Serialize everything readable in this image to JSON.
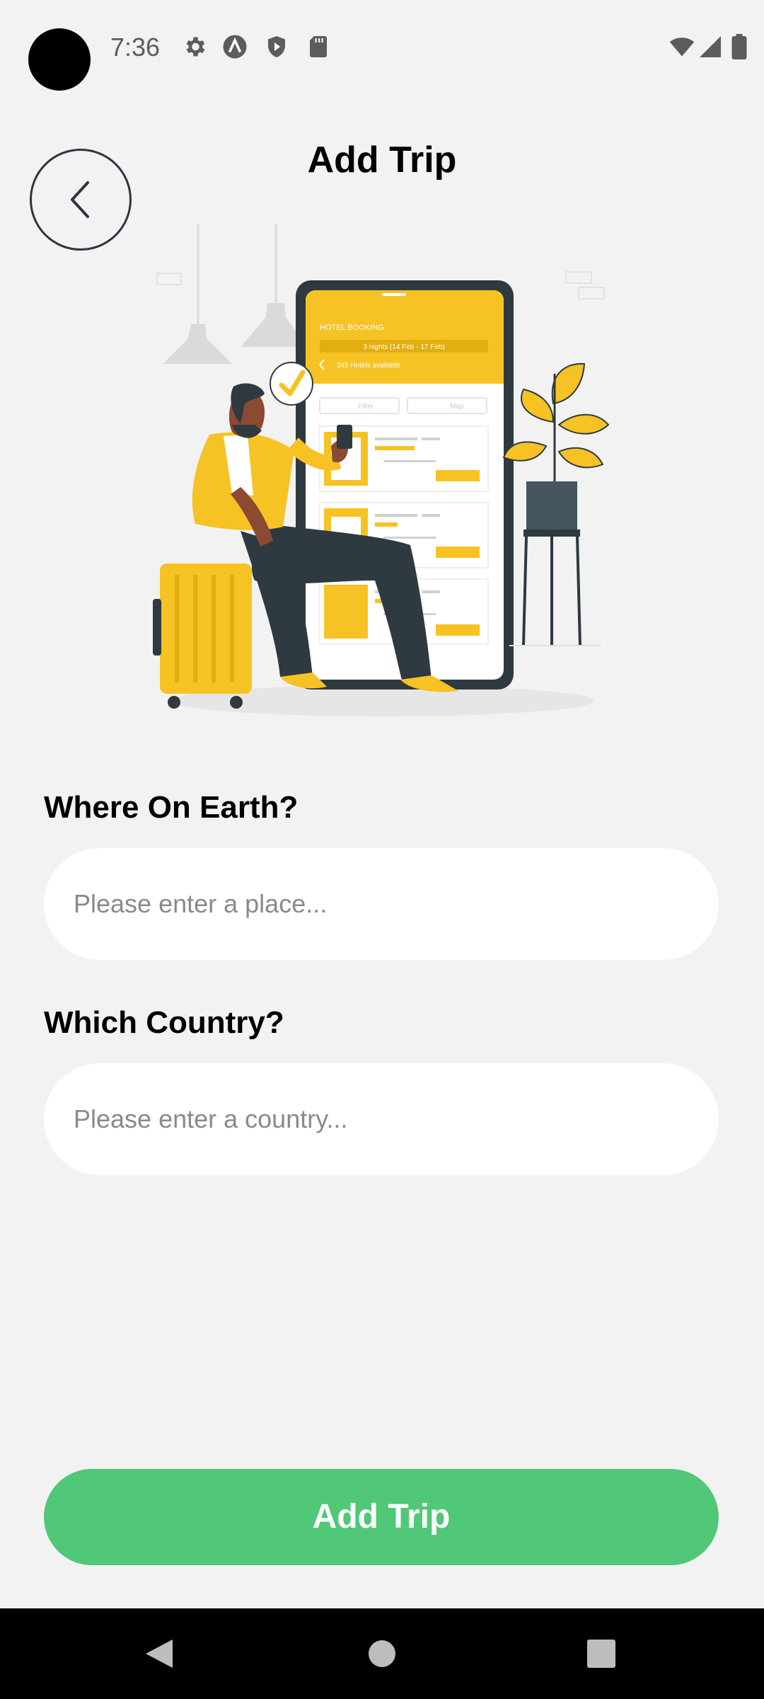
{
  "status_bar": {
    "time": "7:36",
    "icons": [
      "gear-icon",
      "a-circle-icon",
      "shield-play-icon",
      "sd-card-icon",
      "wifi-icon",
      "signal-icon",
      "battery-icon"
    ]
  },
  "header": {
    "title": "Add Trip",
    "back_icon": "chevron-left-icon"
  },
  "illustration": {
    "phone_header": "HOTEL BOOKING",
    "phone_dates": "3 nights (14 Feb - 17 Feb)",
    "phone_results": "345 Hotels available",
    "filter_label": "Filter",
    "map_label": "Map"
  },
  "form": {
    "place_label": "Where On Earth?",
    "place_placeholder": "Please enter a place...",
    "country_label": "Which Country?",
    "country_placeholder": "Please enter a country..."
  },
  "actions": {
    "submit_label": "Add Trip"
  },
  "colors": {
    "background": "#F2F2F2",
    "accent_green": "#50C878",
    "illustration_yellow": "#F6C224",
    "dark": "#2E3A40"
  }
}
